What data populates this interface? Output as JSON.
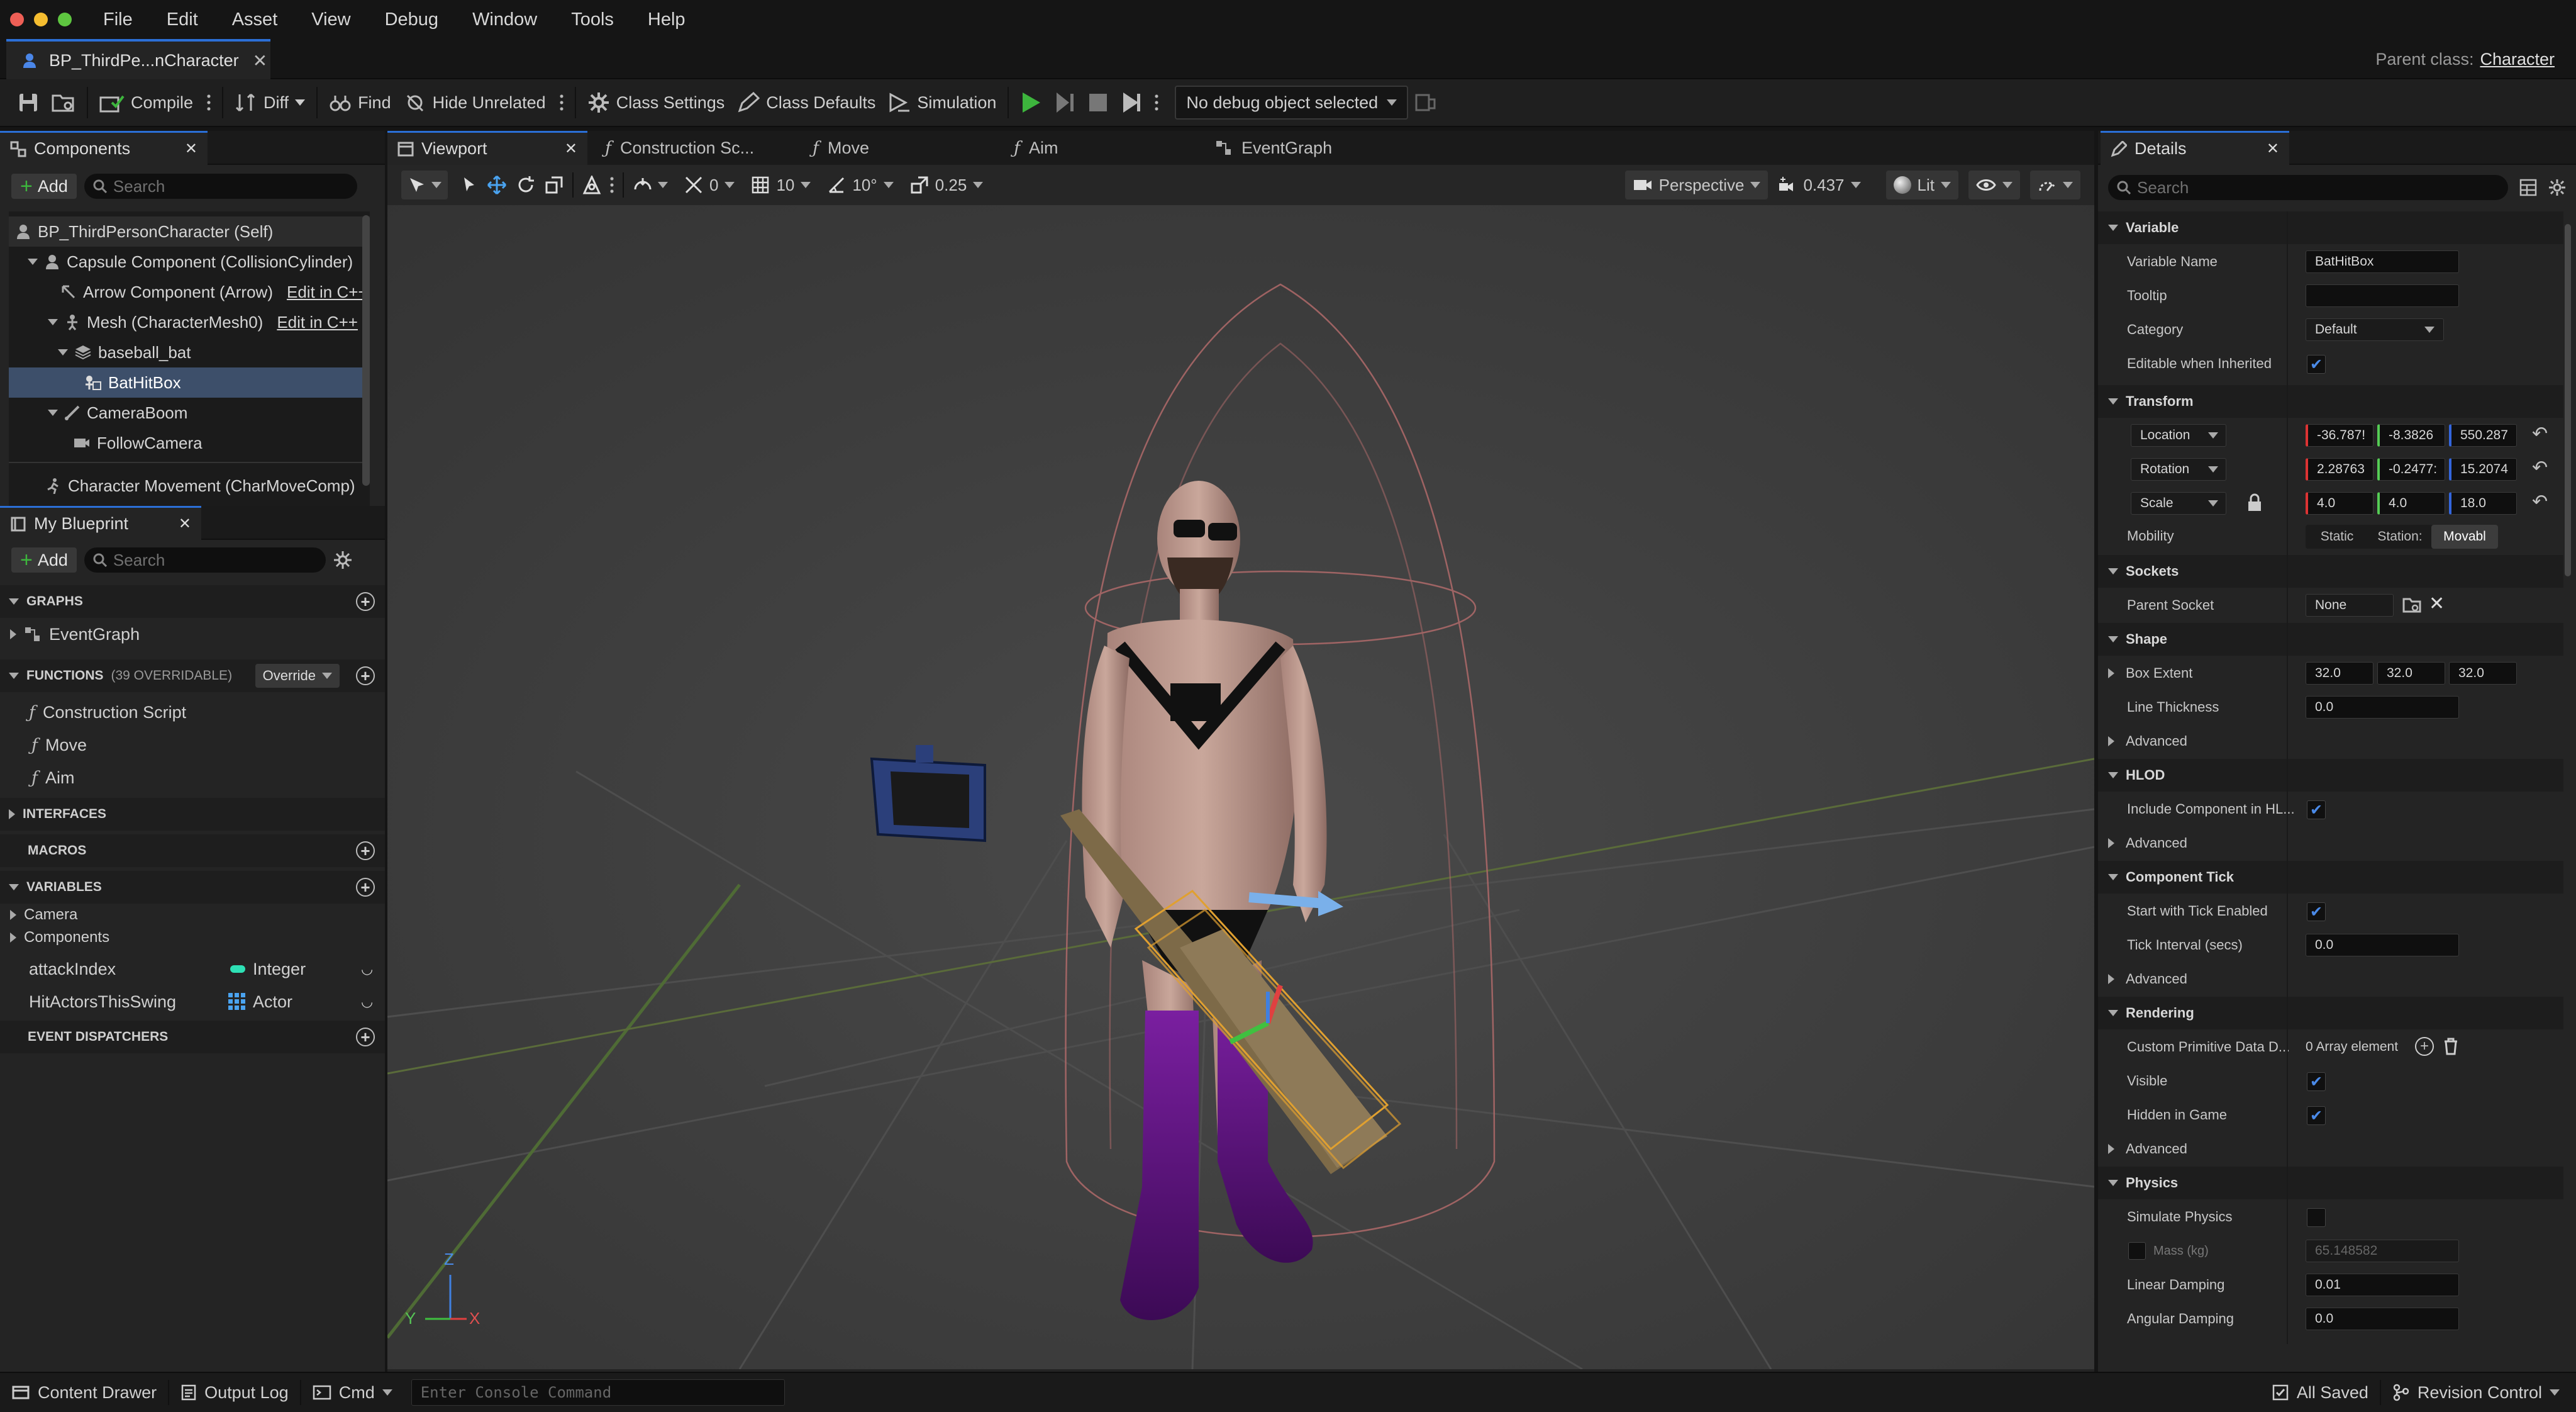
{
  "menu": [
    "File",
    "Edit",
    "Asset",
    "View",
    "Debug",
    "Window",
    "Tools",
    "Help"
  ],
  "doc_tab": {
    "title": "BP_ThirdPe...nCharacter"
  },
  "parent_class": {
    "label": "Parent class:",
    "value": "Character"
  },
  "toolbar": {
    "compile": "Compile",
    "diff": "Diff",
    "find": "Find",
    "hide_unrelated": "Hide Unrelated",
    "class_settings": "Class Settings",
    "class_defaults": "Class Defaults",
    "simulation": "Simulation",
    "debug_object": "No debug object selected"
  },
  "components": {
    "title": "Components",
    "add": "Add",
    "search_placeholder": "Search",
    "items": [
      {
        "label": "BP_ThirdPersonCharacter (Self)",
        "edit": ""
      },
      {
        "label": "Capsule Component (CollisionCylinder)",
        "edit": ""
      },
      {
        "label": "Arrow Component (Arrow)",
        "edit": "Edit in C++"
      },
      {
        "label": "Mesh (CharacterMesh0)",
        "edit": "Edit in C++"
      },
      {
        "label": "baseball_bat",
        "edit": ""
      },
      {
        "label": "BatHitBox",
        "edit": ""
      },
      {
        "label": "CameraBoom",
        "edit": ""
      },
      {
        "label": "FollowCamera",
        "edit": ""
      },
      {
        "label": "Character Movement (CharMoveComp)",
        "edit": ""
      }
    ]
  },
  "my_blueprint": {
    "title": "My Blueprint",
    "add": "Add",
    "search_placeholder": "Search",
    "graphs": "GRAPHS",
    "event_graph": "EventGraph",
    "functions": "FUNCTIONS",
    "functions_count": "(39 OVERRIDABLE)",
    "override": "Override",
    "function_items": [
      "Construction Script",
      "Move",
      "Aim"
    ],
    "interfaces": "INTERFACES",
    "macros": "MACROS",
    "variables": "VARIABLES",
    "var_groups": [
      "Camera",
      "Components"
    ],
    "vars": [
      {
        "name": "attackIndex",
        "type": "Integer"
      },
      {
        "name": "HitActorsThisSwing",
        "type": "Actor"
      }
    ],
    "event_dispatchers": "EVENT DISPATCHERS"
  },
  "viewport": {
    "tabs": [
      "Viewport",
      "Construction Sc...",
      "Move",
      "Aim",
      "EventGraph"
    ],
    "grid_snap": "10",
    "rot_snap": "10°",
    "scale_snap": "0.25",
    "zero": "0",
    "perspective": "Perspective",
    "speed": "0.437",
    "lit": "Lit",
    "axis": {
      "z": "Z",
      "y": "Y",
      "x": "X"
    }
  },
  "details": {
    "title": "Details",
    "search_placeholder": "Search",
    "variable": "Variable",
    "variable_name_label": "Variable Name",
    "variable_name": "BatHitBox",
    "tooltip_label": "Tooltip",
    "category_label": "Category",
    "category": "Default",
    "editable_label": "Editable when Inherited",
    "transform": "Transform",
    "location": "Location",
    "rotation": "Rotation",
    "scale": "Scale",
    "loc": [
      "-36.787!",
      "-8.3826",
      "550.287"
    ],
    "rot": [
      "2.28763",
      "-0.2477:",
      "15.2074"
    ],
    "scl": [
      "4.0",
      "4.0",
      "18.0"
    ],
    "mobility_label": "Mobility",
    "mobility": [
      "Static",
      "Station:",
      "Movabl"
    ],
    "sockets": "Sockets",
    "parent_socket_label": "Parent Socket",
    "parent_socket": "None",
    "shape": "Shape",
    "box_extent_label": "Box Extent",
    "box_extent": [
      "32.0",
      "32.0",
      "32.0"
    ],
    "line_thickness_label": "Line Thickness",
    "line_thickness": "0.0",
    "advanced": "Advanced",
    "hlod": "HLOD",
    "include_hlod_label": "Include Component in HL...",
    "component_tick": "Component Tick",
    "start_tick_label": "Start with Tick Enabled",
    "tick_interval_label": "Tick Interval (secs)",
    "tick_interval": "0.0",
    "rendering": "Rendering",
    "custom_prim_label": "Custom Primitive Data D...",
    "custom_prim": "0 Array element",
    "visible_label": "Visible",
    "hidden_label": "Hidden in Game",
    "physics": "Physics",
    "simulate_label": "Simulate Physics",
    "mass_label": "Mass (kg)",
    "mass": "65.148582",
    "linear_damping_label": "Linear Damping",
    "linear_damping": "0.01",
    "angular_damping_label": "Angular Damping",
    "angular_damping": "0.0"
  },
  "status": {
    "content_drawer": "Content Drawer",
    "output_log": "Output Log",
    "cmd": "Cmd",
    "console_placeholder": "Enter Console Command",
    "all_saved": "All Saved",
    "revision_control": "Revision Control"
  },
  "colors": {
    "accent": "#2b6fd6",
    "play": "#3db53d",
    "selection": "#3d4f6a",
    "highlight": "#374c6a"
  }
}
